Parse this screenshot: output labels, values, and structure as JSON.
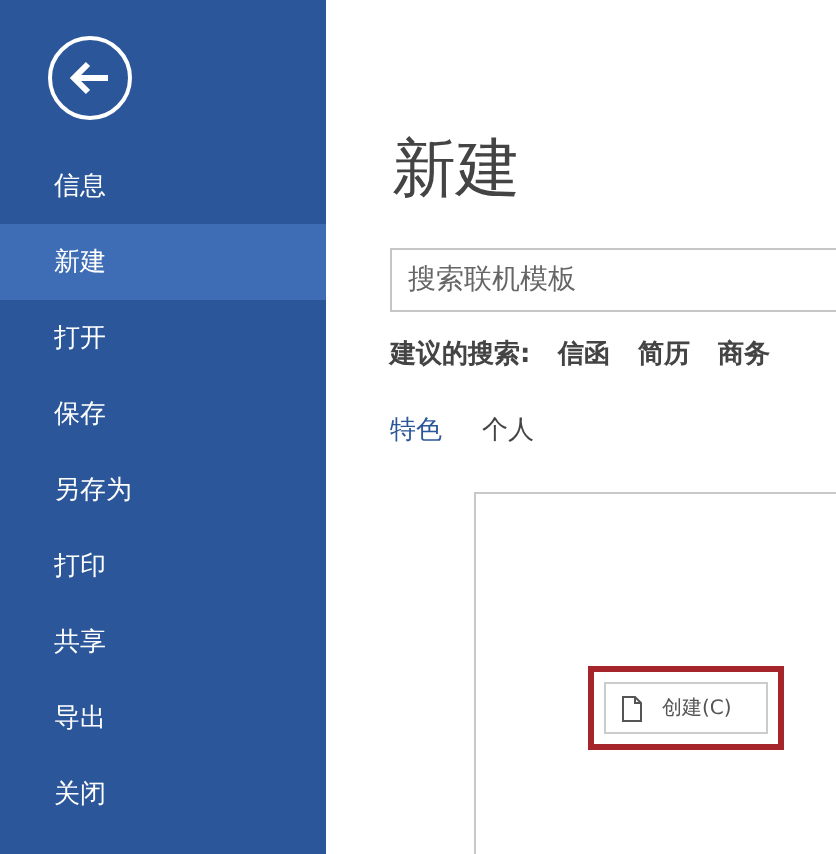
{
  "sidebar": {
    "items": [
      {
        "label": "信息",
        "selected": false
      },
      {
        "label": "新建",
        "selected": true
      },
      {
        "label": "打开",
        "selected": false
      },
      {
        "label": "保存",
        "selected": false
      },
      {
        "label": "另存为",
        "selected": false
      },
      {
        "label": "打印",
        "selected": false
      },
      {
        "label": "共享",
        "selected": false
      },
      {
        "label": "导出",
        "selected": false
      },
      {
        "label": "关闭",
        "selected": false
      }
    ]
  },
  "page_title": "新建",
  "search": {
    "placeholder": "搜索联机模板"
  },
  "suggested": {
    "label": "建议的搜索:",
    "links": [
      "信函",
      "简历",
      "商务"
    ]
  },
  "tabs": [
    {
      "label": "特色",
      "selected": true
    },
    {
      "label": "个人",
      "selected": false
    }
  ],
  "template_card": {
    "create_button": {
      "label": "创建(C)",
      "highlighted": true
    }
  }
}
